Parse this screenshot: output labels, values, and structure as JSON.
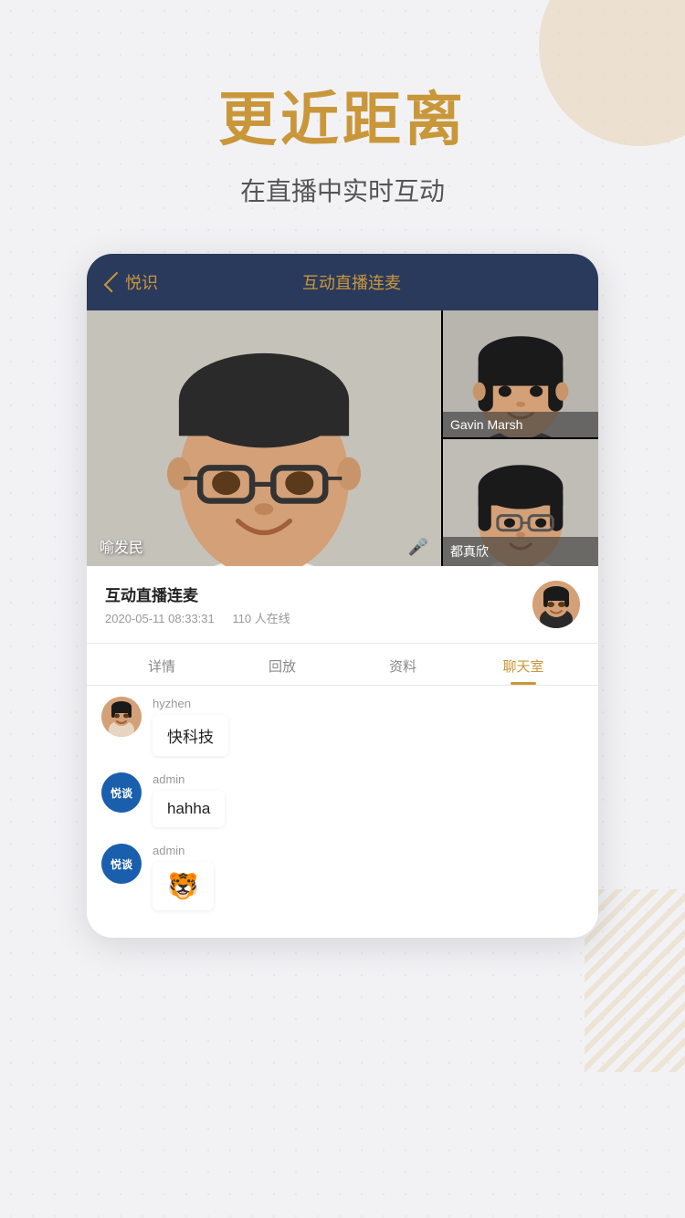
{
  "page": {
    "background": "#f2f2f5"
  },
  "headline": "更近距离",
  "subheadline": "在直播中实时互动",
  "card": {
    "header": {
      "back_label": "悦识",
      "title": "互动直播连麦"
    },
    "video": {
      "main_person": "喻发民",
      "side_top_person": "Gavin Marsh",
      "side_bottom_person": "都真欣"
    },
    "stream": {
      "title": "互动直播连麦",
      "date": "2020-05-11 08:33:31",
      "online_count": "110 人在线"
    },
    "tabs": [
      {
        "label": "详情",
        "active": false
      },
      {
        "label": "回放",
        "active": false
      },
      {
        "label": "资料",
        "active": false
      },
      {
        "label": "聊天室",
        "active": true
      }
    ],
    "chat_messages": [
      {
        "id": 1,
        "username": "hyzhen",
        "avatar_type": "photo",
        "avatar_text": "",
        "message": "快科技",
        "is_emoji": false
      },
      {
        "id": 2,
        "username": "admin",
        "avatar_type": "brand",
        "avatar_text": "悦谈",
        "message": "hahha",
        "is_emoji": false
      },
      {
        "id": 3,
        "username": "admin",
        "avatar_type": "brand",
        "avatar_text": "悦谈",
        "message": "🐯",
        "is_emoji": true
      }
    ]
  }
}
